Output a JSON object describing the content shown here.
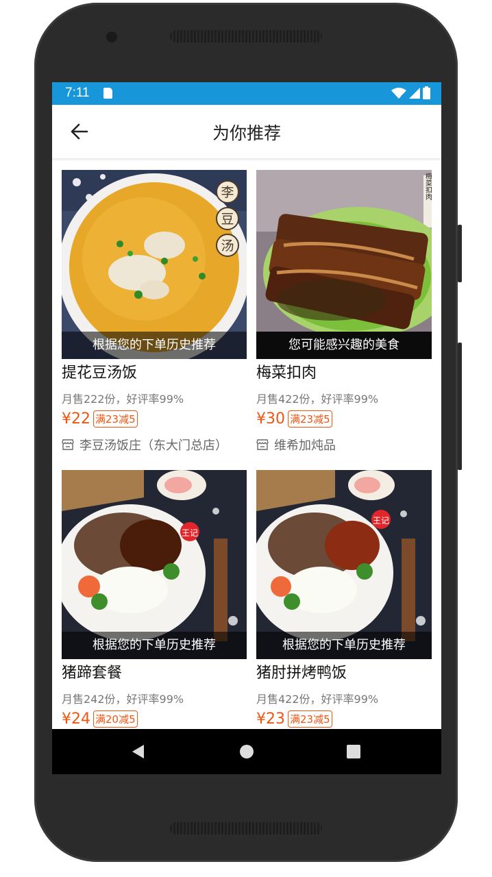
{
  "status_bar": {
    "time": "7:11"
  },
  "header": {
    "title": "为你推荐"
  },
  "products": [
    {
      "caption": "根据您的下单历史推荐",
      "name": "提花豆汤饭",
      "stats": "月售222份，好评率99%",
      "price": "¥22",
      "promo": "满23减5",
      "shop": "李豆汤饭庄（东大门总店）",
      "image": "yellow-rice-soup-photo"
    },
    {
      "caption": "您可能感兴趣的美食",
      "name": "梅菜扣肉",
      "stats": "月售422份，好评率99%",
      "price": "¥30",
      "promo": "满23减5",
      "shop": "维希加炖品",
      "image": "braised-pork-photo"
    },
    {
      "caption": "根据您的下单历史推荐",
      "name": "猪蹄套餐",
      "stats": "月售242份，好评率99%",
      "price": "¥24",
      "promo": "满20减5",
      "image": "pork-trotter-rice-photo"
    },
    {
      "caption": "根据您的下单历史推荐",
      "name": "猪肘拼烤鸭饭",
      "stats": "月售422份，好评率99%",
      "price": "¥23",
      "promo": "满23减5",
      "image": "pork-duck-rice-photo"
    }
  ],
  "colors": {
    "status_bar": "#1796d9",
    "price": "#ee5511",
    "device": "#2b2b2b"
  },
  "image_text": {
    "seal_1": "李",
    "seal_2": "豆",
    "seal_3": "汤",
    "vertical_sign": "梅菜扣肉",
    "brand_mark": "王记"
  }
}
